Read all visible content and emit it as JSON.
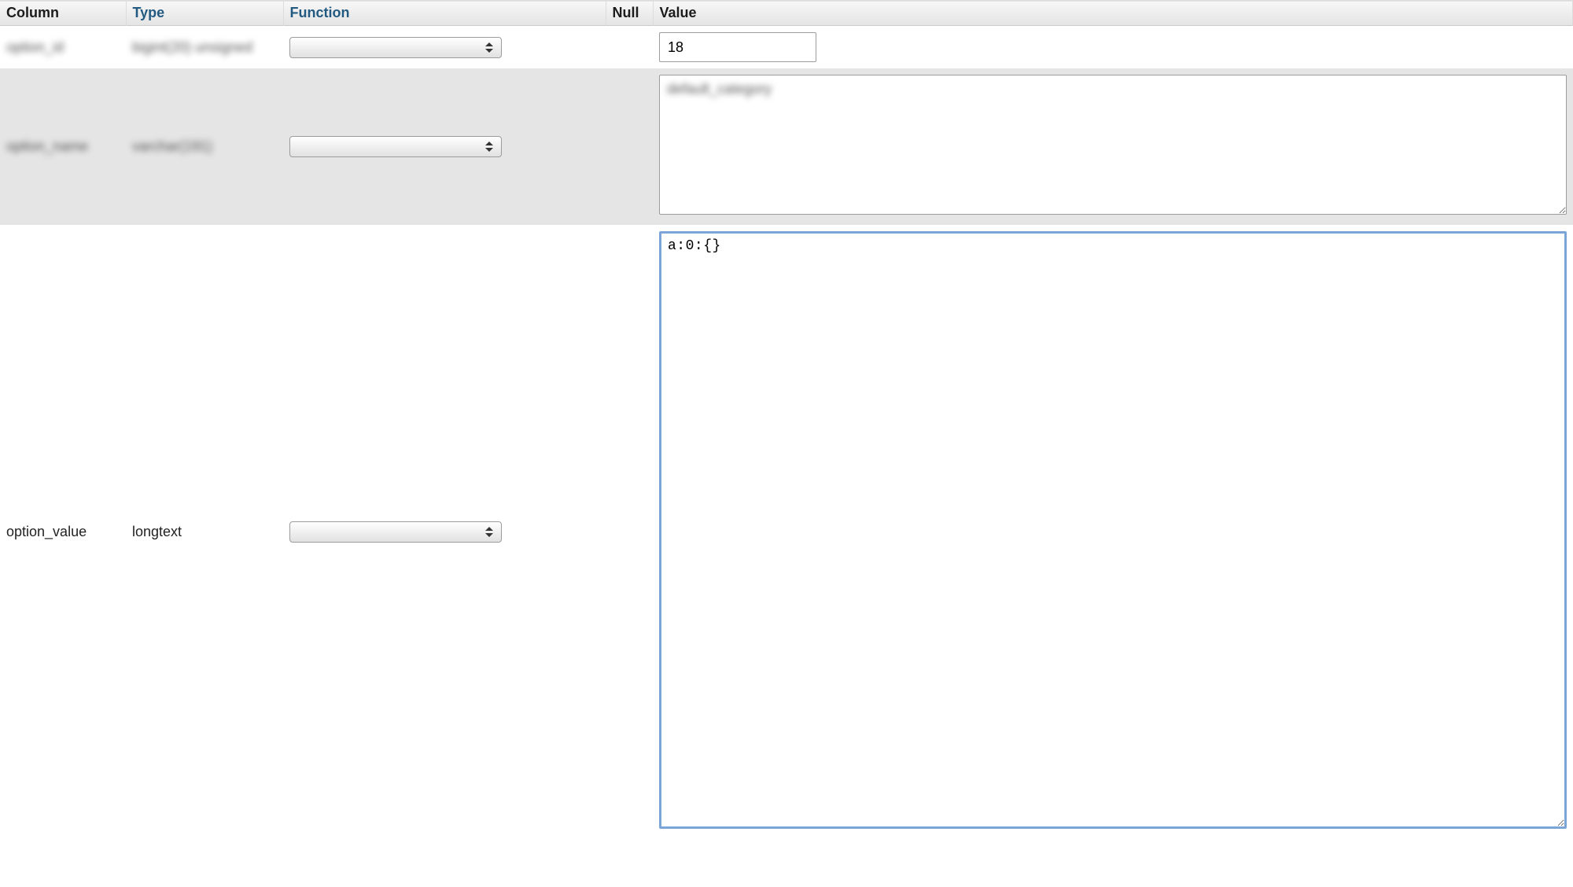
{
  "headers": {
    "column": "Column",
    "type": "Type",
    "function": "Function",
    "null": "Null",
    "value": "Value"
  },
  "rows": [
    {
      "column_blurred": "option_id",
      "type_blurred": "bigint(20) unsigned",
      "function": "",
      "null": "",
      "value": "18"
    },
    {
      "column_blurred": "option_name",
      "type_blurred": "varchar(191)",
      "function": "",
      "null": "",
      "value_blurred": "default_category"
    },
    {
      "column": "option_value",
      "type": "longtext",
      "function": "",
      "null": "",
      "value": "a:0:{}"
    }
  ]
}
